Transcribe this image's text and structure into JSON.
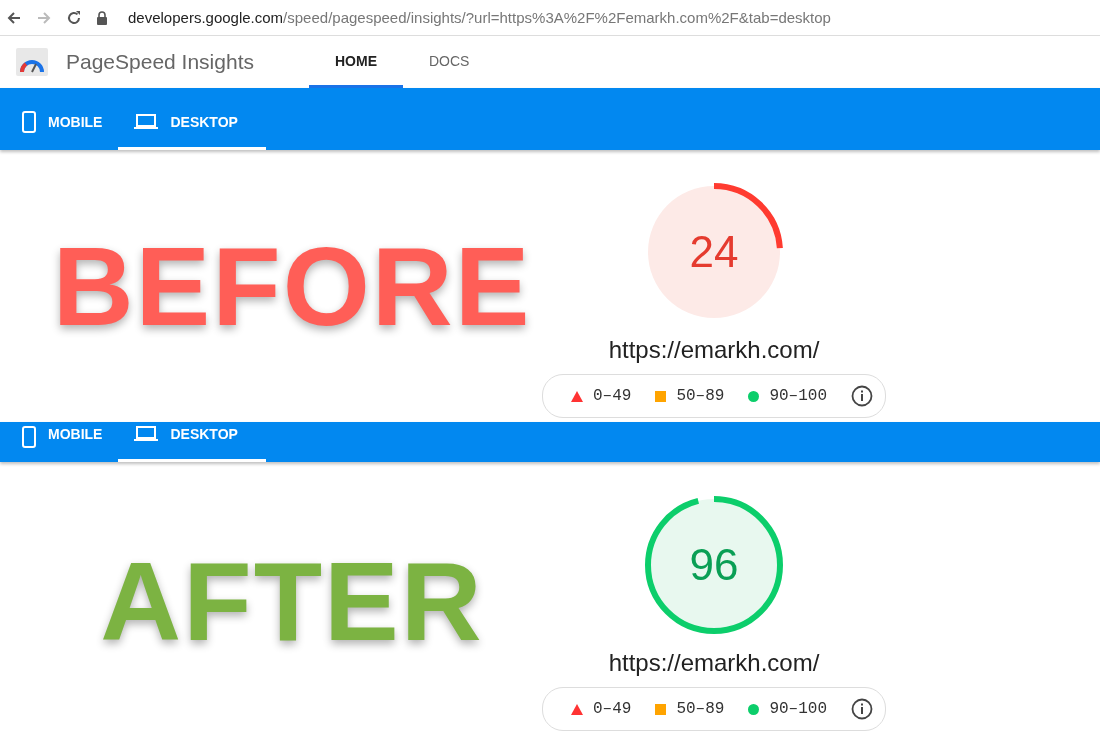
{
  "browser": {
    "domain": "developers.google.com",
    "path": "/speed/pagespeed/insights/?url=https%3A%2F%2Femarkh.com%2F&tab=desktop"
  },
  "header": {
    "title": "PageSpeed Insights",
    "tabs": [
      {
        "label": "HOME",
        "selected": true
      },
      {
        "label": "DOCS",
        "selected": false
      }
    ]
  },
  "panels": [
    {
      "device_tabs": [
        {
          "label": "MOBILE",
          "kind": "mobile",
          "selected": false
        },
        {
          "label": "DESKTOP",
          "kind": "desktop",
          "selected": true
        }
      ],
      "caption": "BEFORE",
      "color": "#ff5e57",
      "score": "24",
      "level": 0.24,
      "kind": "poor",
      "url": "https://emarkh.com/",
      "legend": [
        {
          "label": "0–49",
          "kind": "fail"
        },
        {
          "label": "50–89",
          "kind": "average"
        },
        {
          "label": "90–100",
          "kind": "pass"
        }
      ]
    },
    {
      "device_tabs": [
        {
          "label": "MOBILE",
          "kind": "mobile",
          "selected": false
        },
        {
          "label": "DESKTOP",
          "kind": "desktop",
          "selected": true
        }
      ],
      "caption": "AFTER",
      "color": "#7cb342",
      "score": "96",
      "level": 0.96,
      "kind": "good",
      "url": "https://emarkh.com/",
      "legend": [
        {
          "label": "0–49",
          "kind": "fail"
        },
        {
          "label": "50–89",
          "kind": "average"
        },
        {
          "label": "90–100",
          "kind": "pass"
        }
      ]
    }
  ]
}
